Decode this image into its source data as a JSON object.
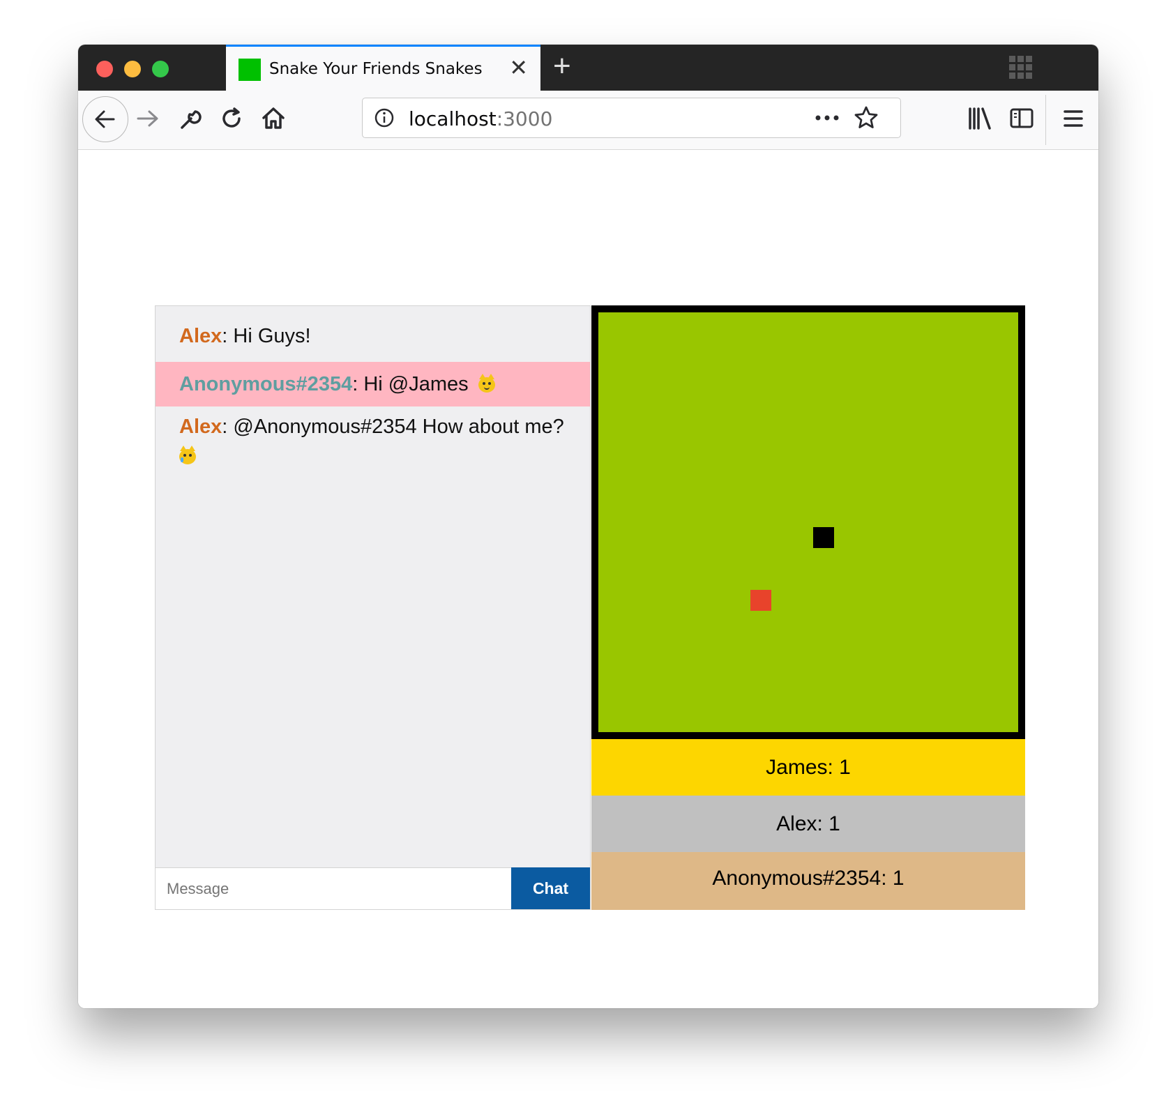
{
  "browser": {
    "tab": {
      "title": "Snake Your Friends Snakes",
      "close_glyph": "✕"
    },
    "new_tab_glyph": "+",
    "urlbar": {
      "host": "localhost",
      "port": ":3000"
    },
    "icons": [
      "back-arrow-icon",
      "forward-arrow-icon",
      "wrench-icon",
      "reload-icon",
      "home-icon",
      "info-icon",
      "more-icon",
      "star-icon",
      "library-icon",
      "sidebar-icon",
      "menu-icon",
      "grid-icon"
    ]
  },
  "chat": {
    "messages": [
      {
        "user": "Alex",
        "sep": ": ",
        "text": "Hi Guys!",
        "emoji": ""
      },
      {
        "user": "Anonymous#2354",
        "sep": ": ",
        "text": "Hi @James",
        "emoji": "smiling-cat"
      },
      {
        "user": "Alex",
        "sep": ": ",
        "text": "@Anonymous#2354 How about me?",
        "emoji": "crying-cat"
      }
    ],
    "input_placeholder": "Message",
    "send_label": "Chat"
  },
  "game": {
    "colors": {
      "border": "#000000",
      "field": "#99c600",
      "snake": "#000000",
      "food": "#e8432b"
    }
  },
  "scores": [
    {
      "label": "James: 1",
      "color": "#fdd600"
    },
    {
      "label": "Alex: 1",
      "color": "#c0c0c0"
    },
    {
      "label": "Anonymous#2354: 1",
      "color": "#deb887"
    }
  ]
}
